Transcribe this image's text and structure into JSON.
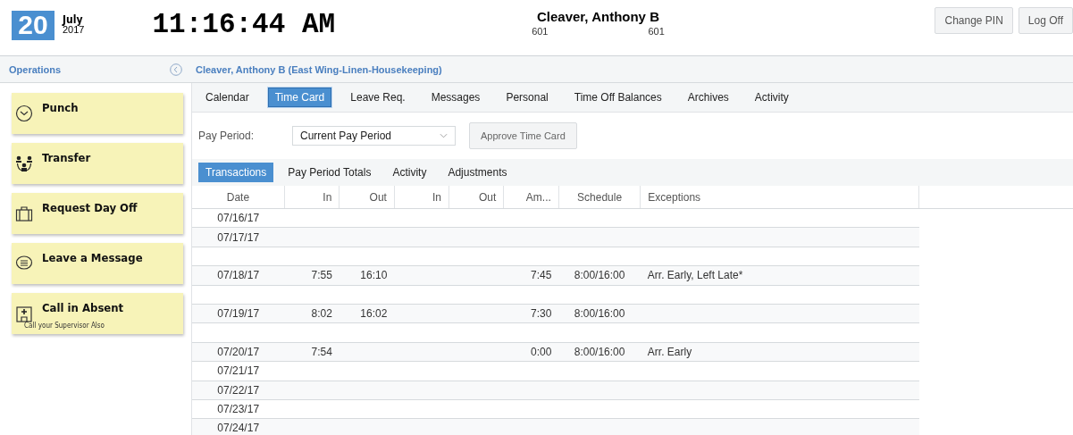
{
  "header": {
    "day": "20",
    "month": "July",
    "year": "2017",
    "clock": "11:16:44 AM",
    "employee_name": "Cleaver, Anthony B",
    "codes": [
      "601",
      "601"
    ],
    "buttons": [
      "Change PIN",
      "Log Off"
    ]
  },
  "sidebar": {
    "title": "Operations",
    "collapse_label": "Cleaver, Anthony B (East Wing-Linen-Housekeeping)",
    "actions": [
      {
        "kind": "clock",
        "label": "Punch"
      },
      {
        "kind": "transfer",
        "label": "Transfer"
      },
      {
        "kind": "briefcase",
        "label": "Request Day Off"
      },
      {
        "kind": "message",
        "label": "Leave a Message"
      },
      {
        "kind": "hospital",
        "label": "Call in Absent",
        "note": "Call your Supervisor Also"
      }
    ]
  },
  "tabs": [
    {
      "label": "Calendar",
      "selected": false
    },
    {
      "label": "Time Card",
      "selected": true
    },
    {
      "label": "Leave Req.",
      "selected": false
    },
    {
      "label": "Messages",
      "selected": false
    },
    {
      "label": "Personal",
      "selected": false
    },
    {
      "label": "Time Off Balances",
      "selected": false
    },
    {
      "label": "Archives",
      "selected": false
    },
    {
      "label": "Activity",
      "selected": false
    }
  ],
  "pay_period": {
    "label": "Pay Period:",
    "value": "Current Pay Period",
    "approve_button": "Approve Time Card"
  },
  "subtabs": [
    {
      "label": "Transactions",
      "selected": true
    },
    {
      "label": "Pay Period Totals",
      "selected": false
    },
    {
      "label": "Activity",
      "selected": false
    },
    {
      "label": "Adjustments",
      "selected": false
    }
  ],
  "table": {
    "columns": [
      "Date",
      "In",
      "Out",
      "In",
      "Out",
      "Am...",
      "Schedule",
      "Exceptions"
    ],
    "rows": [
      {
        "kind": "day",
        "cells": [
          "07/16/17"
        ]
      },
      {
        "kind": "day",
        "cells": [
          "07/17/17"
        ]
      },
      {
        "kind": "blank"
      },
      {
        "kind": "day",
        "cells": [
          "07/18/17",
          "7:55",
          "16:10",
          "",
          "",
          "7:45",
          "8:00/16:00",
          "Arr. Early, Left Late*"
        ]
      },
      {
        "kind": "blank"
      },
      {
        "kind": "day",
        "cells": [
          "07/19/17",
          "8:02",
          "16:02",
          "",
          "",
          "7:30",
          "8:00/16:00"
        ]
      },
      {
        "kind": "blank"
      },
      {
        "kind": "day",
        "cells": [
          "07/20/17",
          "7:54",
          "",
          "",
          "",
          "0:00",
          "8:00/16:00",
          "Arr. Early"
        ]
      },
      {
        "kind": "day",
        "cells": [
          "07/21/17"
        ]
      },
      {
        "kind": "day",
        "cells": [
          "07/22/17"
        ]
      },
      {
        "kind": "day",
        "cells": [
          "07/23/17"
        ]
      },
      {
        "kind": "day",
        "cells": [
          "07/24/17"
        ]
      }
    ]
  }
}
